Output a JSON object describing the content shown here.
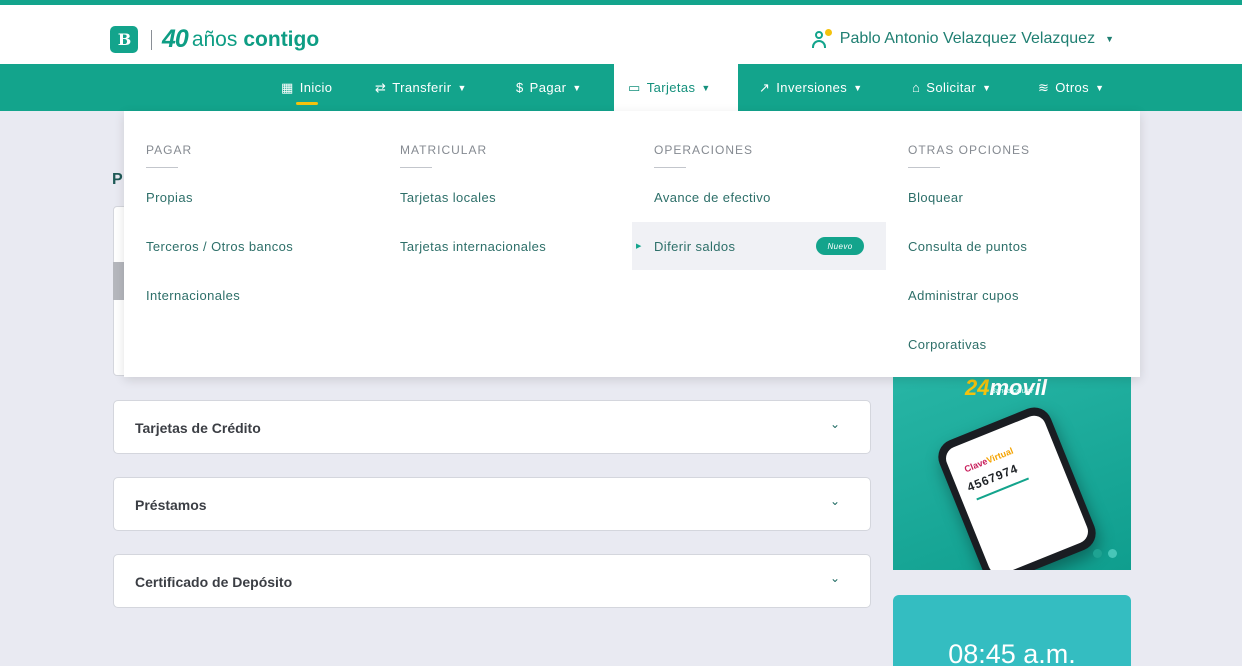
{
  "brand": {
    "logo_text": "B",
    "number": "40",
    "text_regular": "años",
    "text_bold": "contigo"
  },
  "user": {
    "name": "Pablo Antonio Velazquez Velazquez"
  },
  "nav": {
    "items": [
      {
        "label": "Inicio"
      },
      {
        "label": "Transferir"
      },
      {
        "label": "Pagar"
      },
      {
        "label": "Tarjetas"
      },
      {
        "label": "Inversiones"
      },
      {
        "label": "Solicitar"
      },
      {
        "label": "Otros"
      }
    ]
  },
  "menu": {
    "columns": [
      {
        "heading": "PAGAR",
        "items": [
          "Propias",
          "Terceros / Otros bancos",
          "Internacionales"
        ]
      },
      {
        "heading": "MATRICULAR",
        "items": [
          "Tarjetas locales",
          "Tarjetas internacionales"
        ]
      },
      {
        "heading": "OPERACIONES",
        "items": [
          "Avance de efectivo",
          "Diferir saldos"
        ],
        "badge": "Nuevo"
      },
      {
        "heading": "OTRAS OPCIONES",
        "items": [
          "Bloquear",
          "Consulta de puntos",
          "Administrar cupos",
          "Corporativas"
        ]
      }
    ]
  },
  "main": {
    "title_fragment": "P",
    "accordions": [
      {
        "label": "Tarjetas de Crédito"
      },
      {
        "label": "Préstamos"
      },
      {
        "label": "Certificado de Depósito"
      }
    ]
  },
  "promo": {
    "brand_a": "24",
    "brand_b": "movil",
    "sub": "Banca celular",
    "screen_title_a": "Clave",
    "screen_title_b": "Virtual",
    "screen_number": "4567974"
  },
  "clock": {
    "time": "08:45 a.m."
  },
  "colors": {
    "primary": "#13a48c",
    "accent": "#f4c20d",
    "background": "#e9eaf2",
    "clock": "#34bdc1"
  }
}
